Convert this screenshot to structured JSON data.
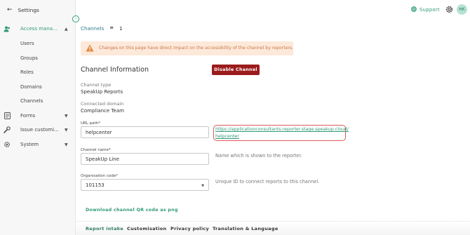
{
  "sidebar": {
    "back_label": "Settings",
    "access_label": "Access mana...",
    "access_items": [
      "Users",
      "Groups",
      "Roles",
      "Domains",
      "Channels"
    ],
    "forms_label": "Forms",
    "issue_label": "Issue customi...",
    "system_label": "System"
  },
  "topbar": {
    "support_label": "Support",
    "avatar_initials": "HK"
  },
  "breadcrumb": {
    "root": "Channels",
    "current": "1"
  },
  "warning": {
    "text": "Changes on this page have direct impact on the accessibility of the channel by reporters."
  },
  "channel_info": {
    "title": "Channel Information",
    "disable_button": "Disable Channel",
    "type_label": "Channel type",
    "type_value": "SpeakUp Reports",
    "domain_label": "Connected domain",
    "domain_value": "Compliance Team"
  },
  "form": {
    "url_path_label": "URL path*",
    "url_path_value": "helpcenter",
    "url_link_line1": "https://applicationconsultants.reporter.stage.speakup.cloud/",
    "url_link_line2": "helpcenter",
    "channel_name_label": "Channel name*",
    "channel_name_value": "SpeakUp Line",
    "channel_name_hint": "Name which is shown to the reporter.",
    "org_code_label": "Organisation code*",
    "org_code_value": "101153",
    "org_code_hint": "Unique ID to connect reports to this channel."
  },
  "qr_link": "Download channel QR code as png",
  "tabs": [
    "Report intake",
    "Customisation",
    "Privacy policy",
    "Translation & Language"
  ],
  "colors": {
    "accent": "#2f9a74",
    "danger": "#9b1c1c",
    "warning_bg": "#fde9d9",
    "warning_text": "#c9774a"
  }
}
